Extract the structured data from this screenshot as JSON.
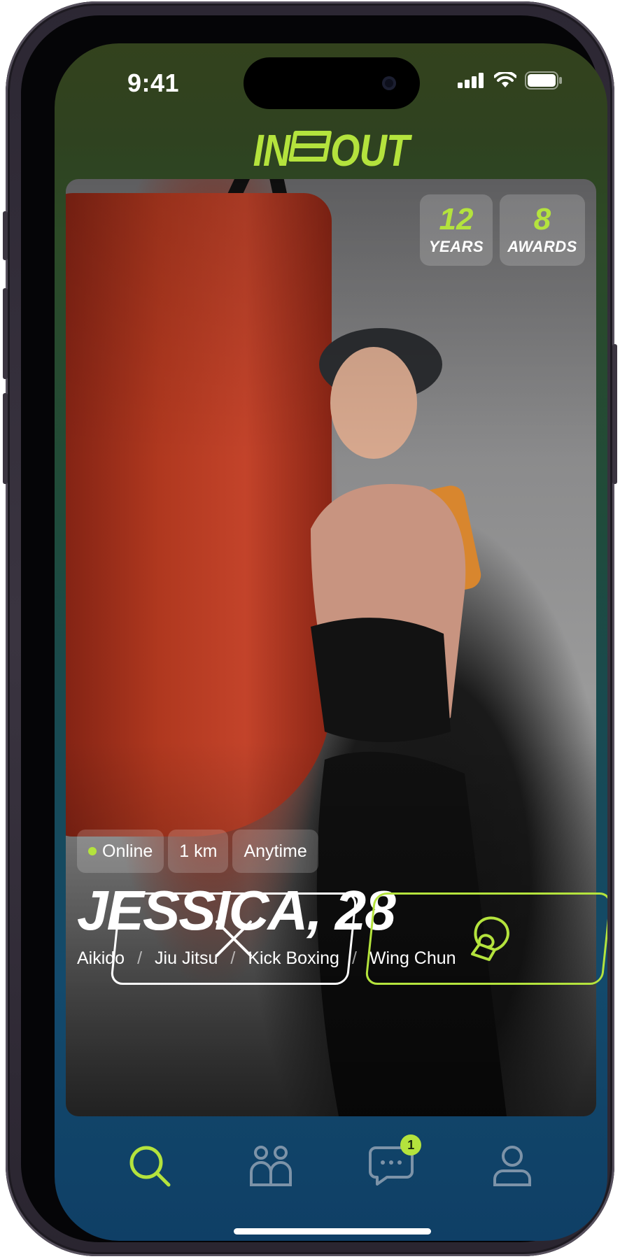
{
  "status_bar": {
    "time": "9:41"
  },
  "app": {
    "logo_left": "IN",
    "logo_right": "OUT"
  },
  "profile": {
    "stats": [
      {
        "value": "12",
        "label": "YEARS"
      },
      {
        "value": "8",
        "label": "AWARDS"
      }
    ],
    "tags": [
      "Online",
      "1 km",
      "Anytime"
    ],
    "name_age": "JESSICA, 28",
    "styles": [
      "Aikido",
      "Jiu Jitsu",
      "Kick Boxing",
      "Wing Chun"
    ],
    "separator": "/"
  },
  "actions": {
    "pass_icon": "close-icon",
    "fight_icon": "boxing-glove-icon"
  },
  "tabbar": {
    "items": [
      {
        "name": "search-icon",
        "active": true
      },
      {
        "name": "people-icon",
        "active": false
      },
      {
        "name": "chat-icon",
        "active": false,
        "badge": "1"
      },
      {
        "name": "profile-icon",
        "active": false
      }
    ]
  },
  "colors": {
    "accent": "#b4e33d",
    "inactive": "#7d93a8"
  }
}
